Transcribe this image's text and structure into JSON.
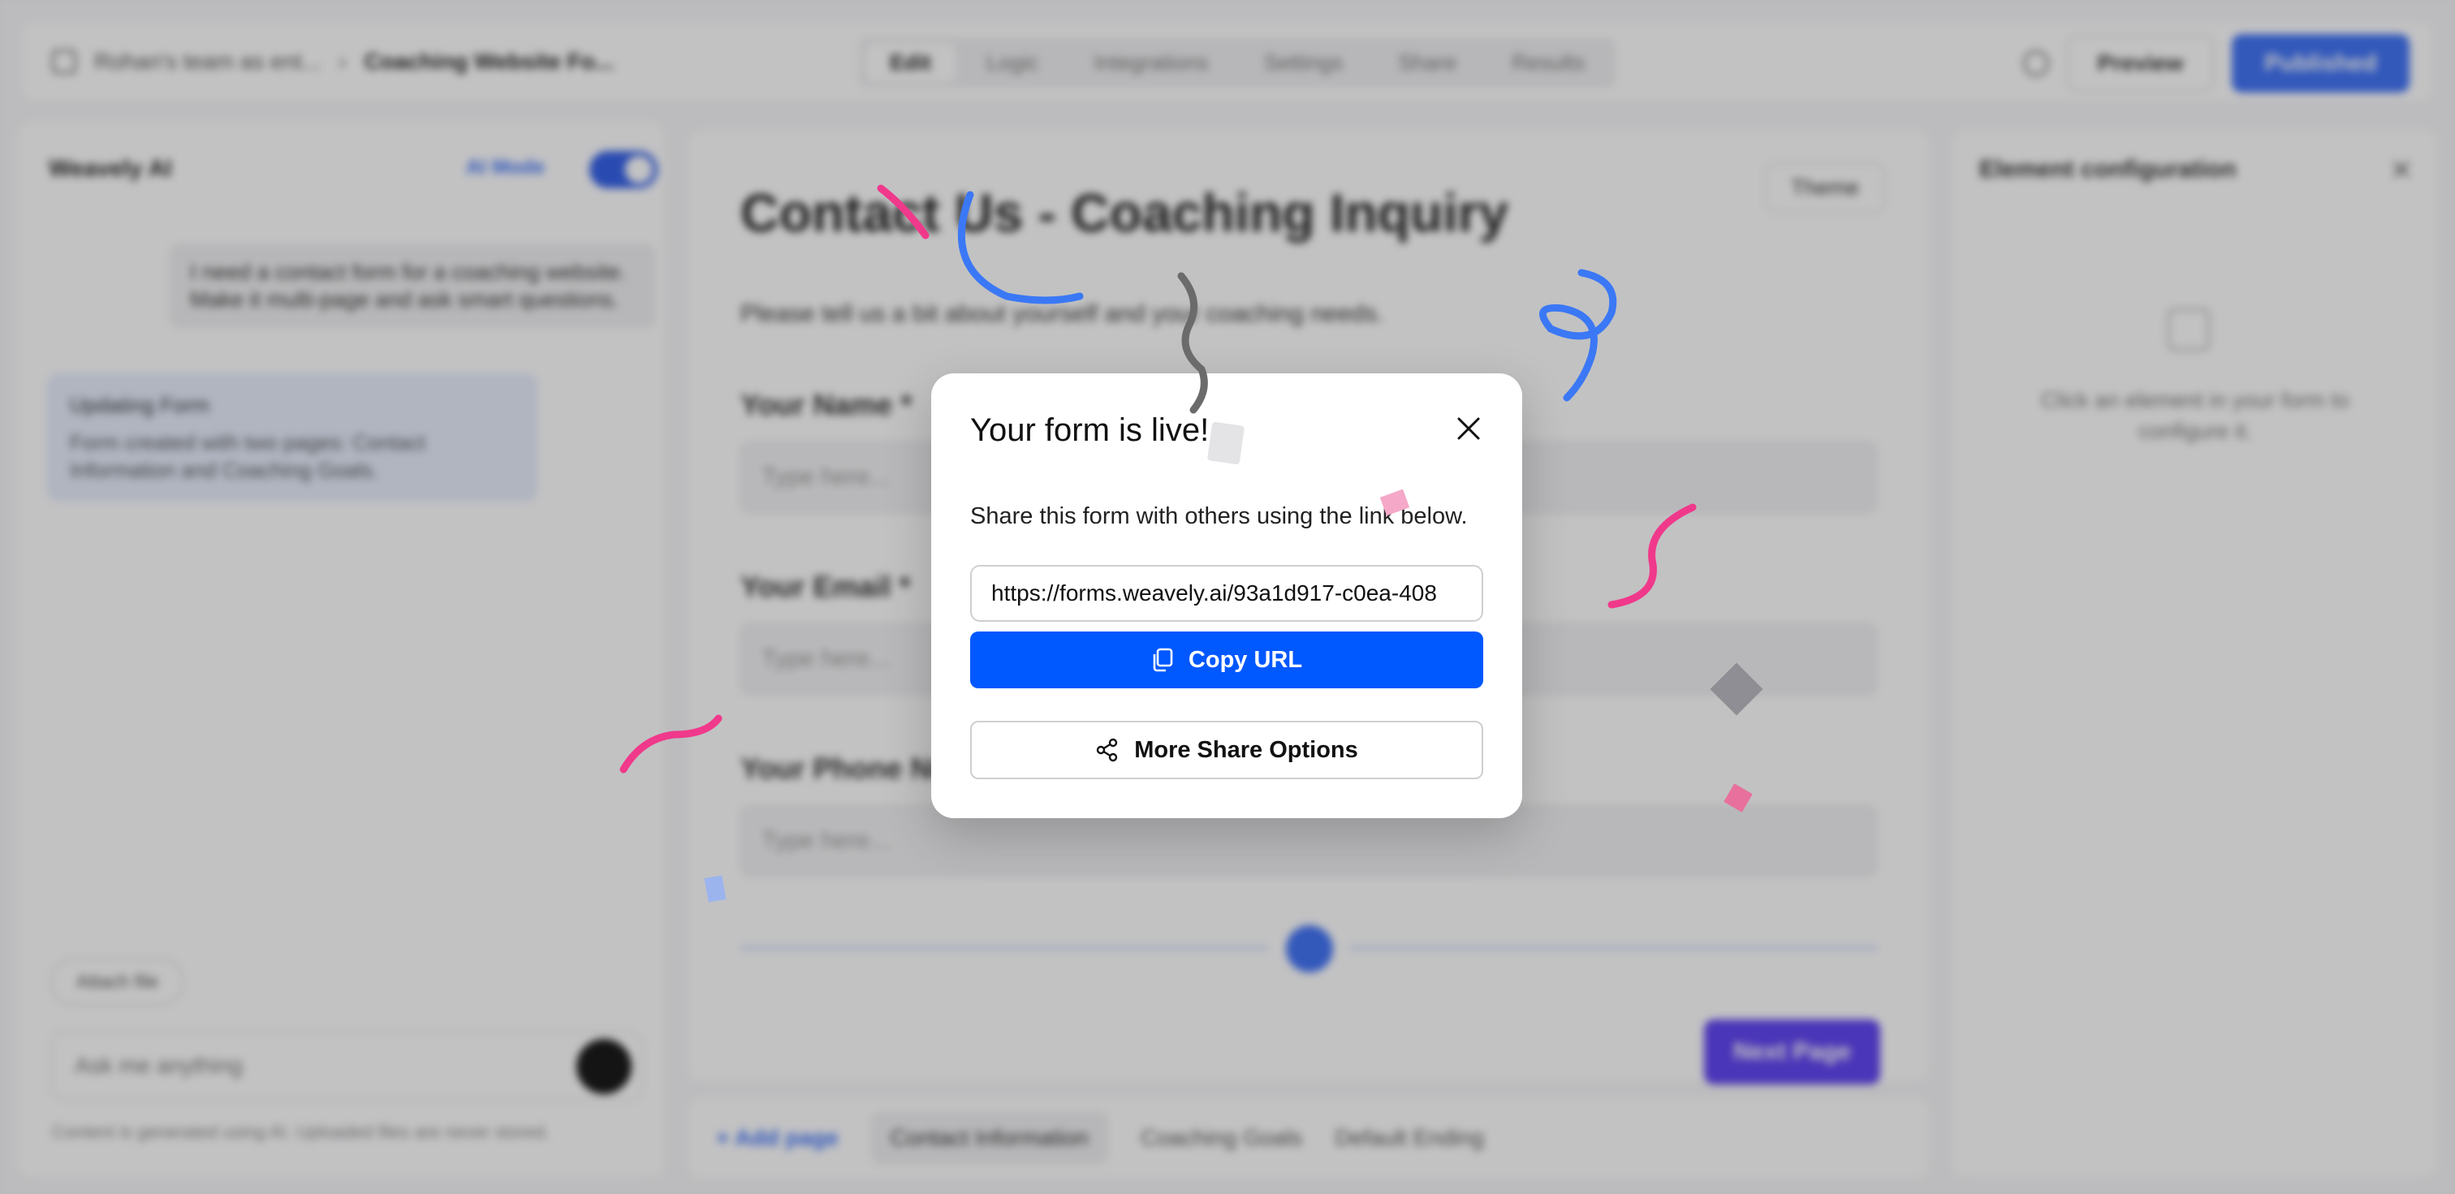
{
  "header": {
    "breadcrumb_team": "Rohan's team as ent...",
    "breadcrumb_current": "Coaching Website Fo...",
    "tabs": [
      "Edit",
      "Logic",
      "Integrations",
      "Settings",
      "Share",
      "Results"
    ],
    "preview_label": "Preview",
    "published_label": "Published"
  },
  "sidebar": {
    "title": "Weavely AI",
    "ai_mode_label": "AI Mode",
    "user_message": "I need a contact form for a coaching website. Make it multi-page and ask smart questions.",
    "update_title": "Updating Form",
    "update_body": "Form created with two pages: Contact Information and Coaching Goals.",
    "attach_label": "Attach file",
    "ask_placeholder": "Ask me anything",
    "disclaimer": "Content is generated using AI. Uploaded files are never stored."
  },
  "form": {
    "title": "Contact Us - Coaching Inquiry",
    "theme_label": "Theme",
    "subtitle": "Please tell us a bit about yourself and your coaching needs.",
    "fields": [
      {
        "label": "Your Name *",
        "placeholder": "Type here..."
      },
      {
        "label": "Your Email *",
        "placeholder": "Type here..."
      },
      {
        "label": "Your Phone Number",
        "placeholder": "Type here..."
      }
    ],
    "next_label": "Next Page"
  },
  "config": {
    "title": "Element configuration",
    "message": "Click an element in your form to configure it."
  },
  "pages": {
    "add_label": "+ Add page",
    "items": [
      "Contact Information",
      "Coaching Goals",
      "Default Ending"
    ]
  },
  "modal": {
    "title": "Your form is live!",
    "description": "Share this form with others using the link below.",
    "url": "https://forms.weavely.ai/93a1d917-c0ea-408",
    "copy_label": "Copy URL",
    "share_label": "More Share Options"
  },
  "colors": {
    "primary_button": "#0058ff",
    "confetti": [
      "#3b78f5",
      "#f0398b",
      "#6b6b6b"
    ]
  }
}
